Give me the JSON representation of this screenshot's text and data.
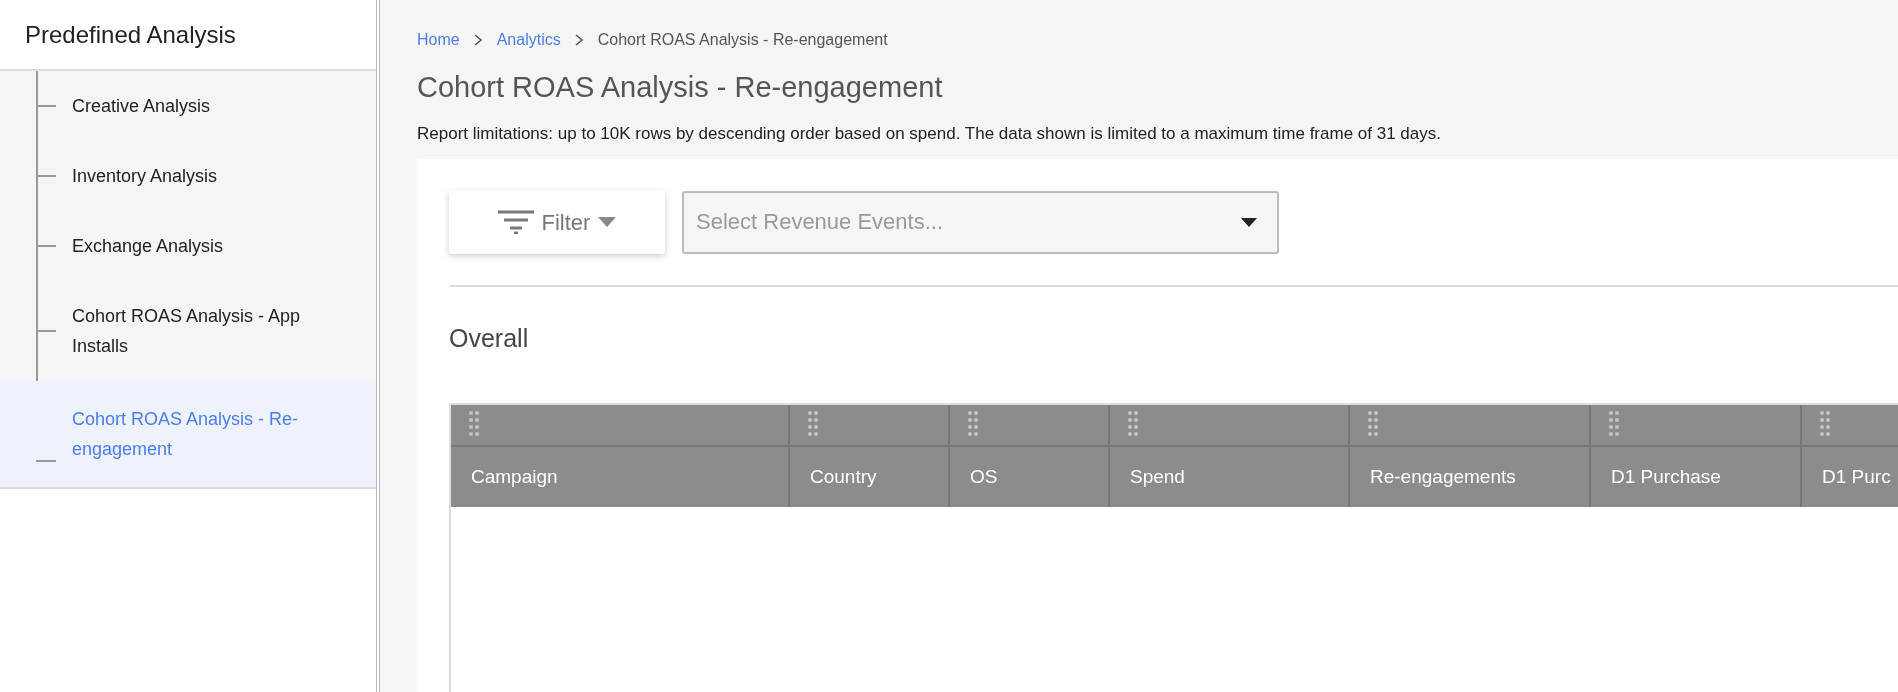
{
  "sidebar": {
    "title": "Predefined Analysis",
    "items": [
      {
        "label": "Creative Analysis",
        "selected": false
      },
      {
        "label": "Inventory Analysis",
        "selected": false
      },
      {
        "label": "Exchange Analysis",
        "selected": false
      },
      {
        "label": "Cohort ROAS Analysis - App Installs",
        "selected": false
      },
      {
        "label": "Cohort ROAS Analysis - Re-engagement",
        "selected": true
      }
    ]
  },
  "breadcrumb": [
    {
      "label": "Home",
      "kind": "link"
    },
    {
      "label": "Analytics",
      "kind": "link"
    },
    {
      "label": "Cohort ROAS Analysis - Re-engagement",
      "kind": "current"
    }
  ],
  "page_title": "Cohort ROAS Analysis - Re-engagement",
  "note": "Report limitations: up to 10K rows by descending order based on spend. The data shown is limited to a maximum time frame of 31 days.",
  "filter_button": {
    "label": "Filter"
  },
  "revenue_select": {
    "placeholder": "Select Revenue Events..."
  },
  "section_title": "Overall",
  "table": {
    "columns": [
      "Campaign",
      "Country",
      "OS",
      "Spend",
      "Re-engagements",
      "D1 Purchase",
      "D1 Purc"
    ]
  }
}
